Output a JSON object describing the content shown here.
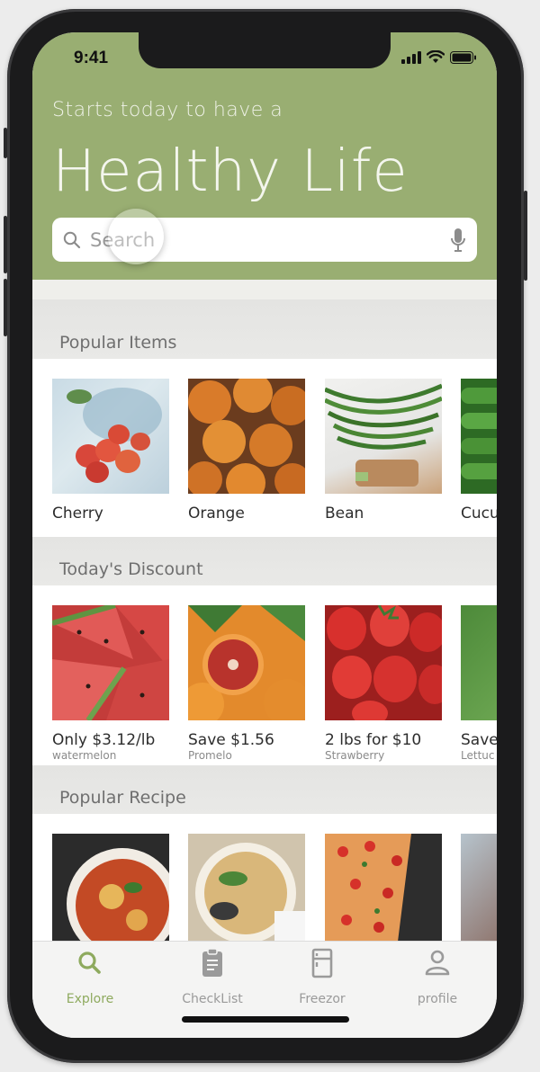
{
  "status": {
    "time": "9:41"
  },
  "header": {
    "tagline": "Starts today to have a",
    "title": "Healthy Life",
    "bg_color": "#99ae72"
  },
  "search": {
    "placeholder": "Search",
    "icon": "search-icon",
    "mic_icon": "mic-icon"
  },
  "sections": {
    "popular_items": {
      "title": "Popular Items",
      "items": [
        {
          "name": "Cherry"
        },
        {
          "name": "Orange"
        },
        {
          "name": "Bean"
        },
        {
          "name": "Cucu"
        }
      ]
    },
    "todays_discount": {
      "title": "Today's Discount",
      "items": [
        {
          "deal": "Only $3.12/lb",
          "name": "watermelon"
        },
        {
          "deal": "Save $1.56",
          "name": "Promelo"
        },
        {
          "deal": "2 lbs for $10",
          "name": "Strawberry"
        },
        {
          "deal": "Save",
          "name": "Lettuc"
        }
      ]
    },
    "popular_recipe": {
      "title": "Popular Recipe"
    }
  },
  "tabbar": {
    "active_color": "#8eaa5e",
    "tabs": [
      {
        "label": "Explore",
        "icon": "search-icon",
        "active": true
      },
      {
        "label": "CheckList",
        "icon": "clipboard-icon",
        "active": false
      },
      {
        "label": "Freezor",
        "icon": "fridge-icon",
        "active": false
      },
      {
        "label": "profile",
        "icon": "person-icon",
        "active": false
      }
    ]
  }
}
